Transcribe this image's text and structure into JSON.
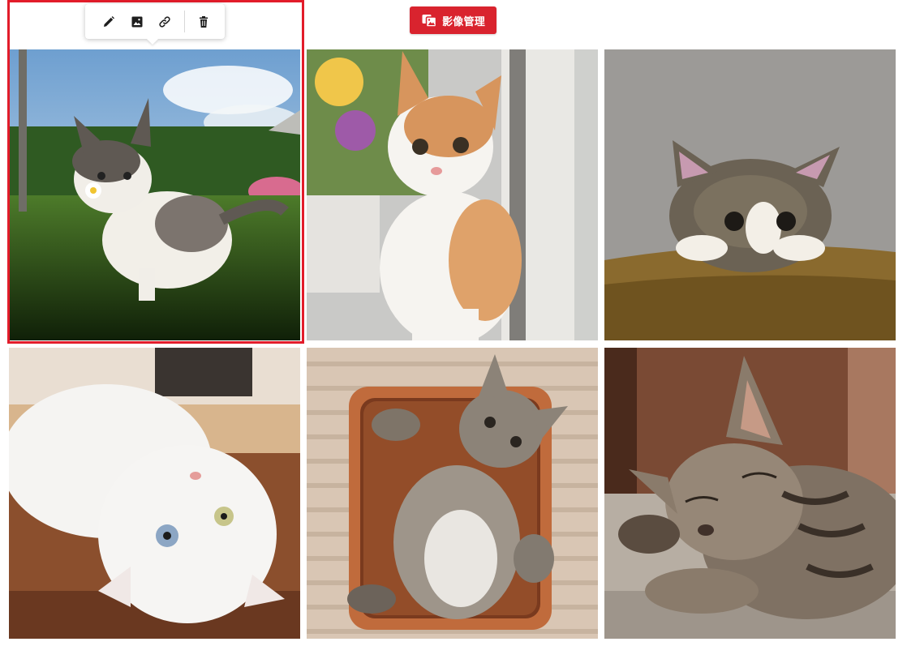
{
  "header": {
    "media_button_label": "影像管理",
    "media_button_icon": "images-icon",
    "accent_color": "#d9232e"
  },
  "toolbar": {
    "edit_icon": "pencil-icon",
    "replace_icon": "image-icon",
    "link_icon": "link-icon",
    "delete_icon": "trash-icon"
  },
  "gallery": {
    "images": [
      {
        "name": "kitten-with-daisy",
        "selected": true
      },
      {
        "name": "orange-white-cat-looking-up",
        "selected": false
      },
      {
        "name": "tabby-kitten-on-sofa",
        "selected": false
      },
      {
        "name": "white-cat-lying-upside-down",
        "selected": false
      },
      {
        "name": "tabby-kitten-in-basket",
        "selected": false
      },
      {
        "name": "sleeping-tabby-kitten",
        "selected": false
      }
    ]
  }
}
